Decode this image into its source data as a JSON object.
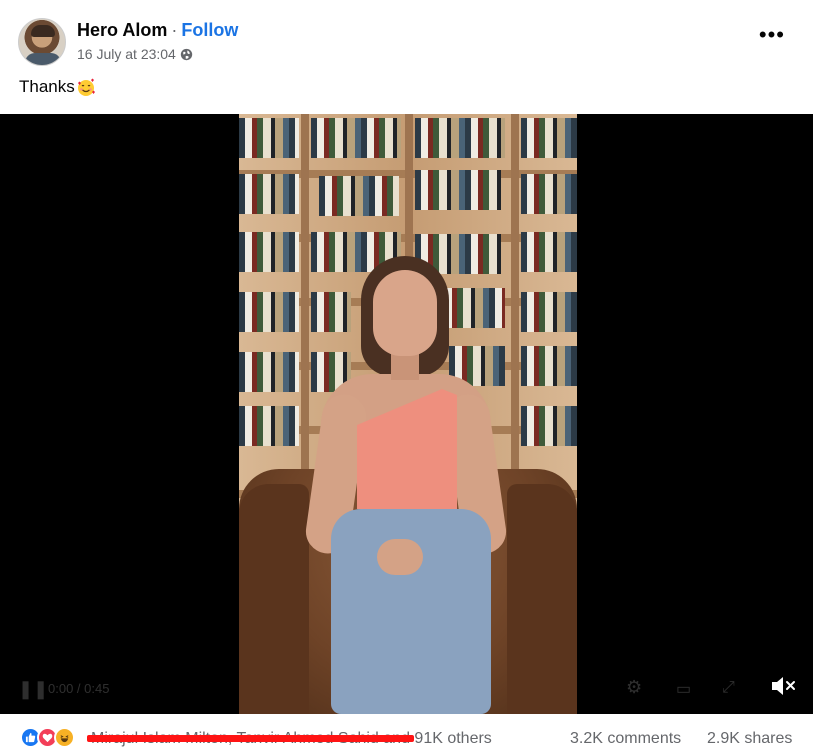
{
  "post": {
    "author": "Hero Alom",
    "separator": "·",
    "follow_label": "Follow",
    "timestamp": "16 July at 23:04",
    "privacy_icon": "globe-icon",
    "more_icon": "more-options-icon",
    "more_label": "•••",
    "caption": "Thanks",
    "caption_emoji": "smiling-face-with-hearts"
  },
  "video": {
    "controls": {
      "play_glyph": "❚❚",
      "time": "0:00 / 0:45",
      "settings_glyph": "⚙",
      "pip_glyph": "▭",
      "fullscreen_glyph": "⤢",
      "mute_icon": "speaker-muted-icon"
    }
  },
  "footer": {
    "reactions": [
      "like",
      "love",
      "haha"
    ],
    "reactor_names": "Mirajul Islam Milton, Tanvir Ahmed Sahid and",
    "reactor_count": "91K others",
    "comments": "3.2K comments",
    "shares": "2.9K shares"
  },
  "colors": {
    "link": "#1b74e4",
    "secondary_text": "#65676b",
    "redaction": "#ff1414",
    "like": "#1877f2",
    "love": "#f33e58",
    "haha": "#f7b125"
  }
}
